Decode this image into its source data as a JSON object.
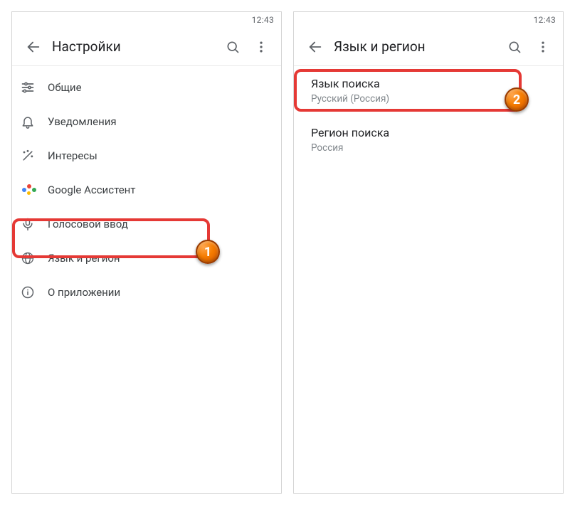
{
  "left": {
    "status_time": "12:43",
    "title": "Настройки",
    "items": [
      {
        "label": "Общие"
      },
      {
        "label": "Уведомления"
      },
      {
        "label": "Интересы"
      },
      {
        "label": "Google Ассистент"
      },
      {
        "label": "Голосовой ввод"
      },
      {
        "label": "Язык и регион"
      },
      {
        "label": "О приложении"
      }
    ],
    "badge": "1"
  },
  "right": {
    "status_time": "12:43",
    "title": "Язык и регион",
    "items": [
      {
        "primary": "Язык поиска",
        "secondary": "Русский (Россия)"
      },
      {
        "primary": "Регион поиска",
        "secondary": "Россия"
      }
    ],
    "badge": "2"
  }
}
